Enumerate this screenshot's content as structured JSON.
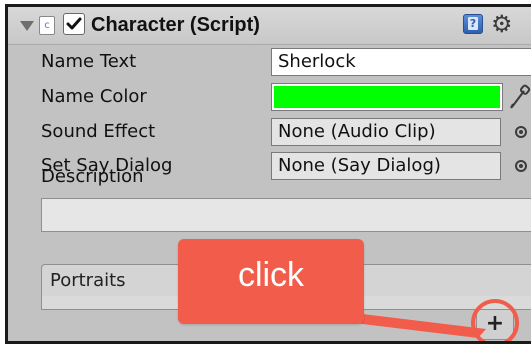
{
  "component": {
    "title": "Character (Script)",
    "enabled": true,
    "icons": {
      "foldout": "foldout-down-triangle-icon",
      "script": "script-file-icon",
      "checkbox": "checkmark-icon",
      "help": "help-book-icon",
      "settings": "gear-icon"
    }
  },
  "properties": {
    "name_text": {
      "label": "Name Text",
      "value": "Sherlock"
    },
    "name_color": {
      "label": "Name Color",
      "color": "#00ff00"
    },
    "sound_effect": {
      "label": "Sound Effect",
      "value": "None (Audio Clip)"
    },
    "set_say_dialog": {
      "label": "Set Say Dialog",
      "value": "None (Say Dialog)"
    },
    "description": {
      "label": "Description",
      "value": ""
    }
  },
  "portraits": {
    "label": "Portraits",
    "add_label": "+"
  },
  "annotation": {
    "text": "click",
    "color": "#f25c4b"
  },
  "colors": {
    "panel_bg": "#c2c2c2",
    "header_bg": "#d0d0d0",
    "field_bg": "#e4e4e4",
    "border": "#1a1a1a"
  }
}
